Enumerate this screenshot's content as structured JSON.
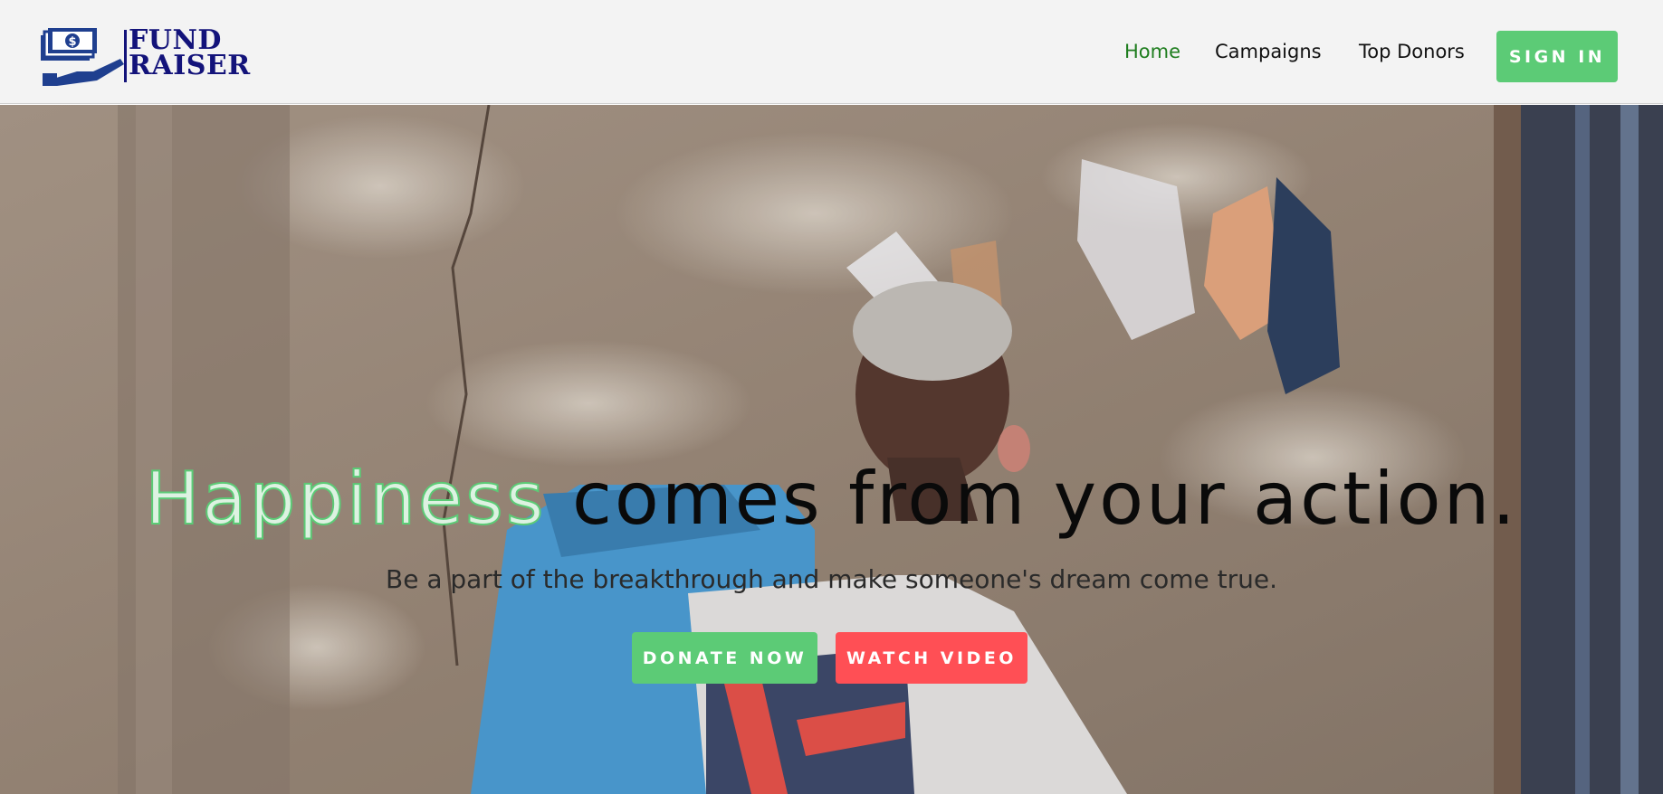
{
  "brand": {
    "line1": "FUND",
    "line2": "RAISER",
    "logo_icon": "money-hand-icon",
    "color": "#13137a"
  },
  "nav": {
    "items": [
      {
        "label": "Home",
        "active": true
      },
      {
        "label": "Campaigns",
        "active": false
      },
      {
        "label": "Top Donors",
        "active": false
      }
    ],
    "signin_label": "SIGN IN"
  },
  "hero": {
    "headline_accent": "Happiness",
    "headline_rest": " comes from your action.",
    "subheadline": "Be a part of the breakthrough and make someone's dream come true.",
    "donate_label": "DONATE NOW",
    "watch_label": "WATCH VIDEO"
  },
  "colors": {
    "accent_green": "#5ccb76",
    "active_link": "#1e7d1e",
    "watch_red": "#ff4f55",
    "navbar_bg": "#f3f3f3"
  }
}
